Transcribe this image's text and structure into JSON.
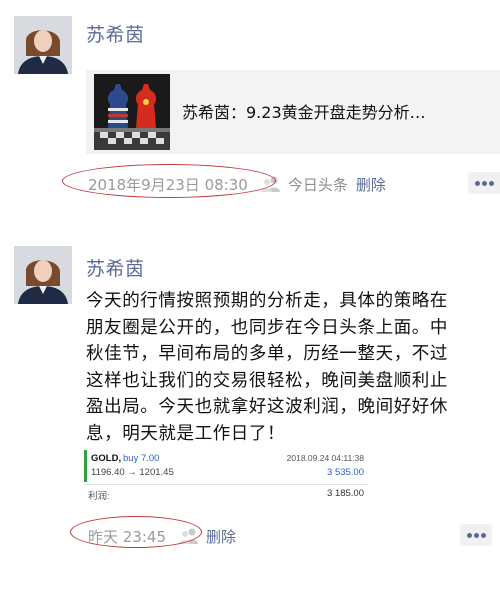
{
  "posts": [
    {
      "author": "苏希茵",
      "share_title": "苏希茵：9.23黄金开盘走势分析…",
      "time": "2018年9月23日 08:30",
      "source": "今日头条",
      "delete_label": "删除"
    },
    {
      "author": "苏希茵",
      "text_lines": [
        "今天的行情按照预期的分析走，具体的策略在",
        "朋友圈是公开的，也同步在今日头条上面。中",
        "秋佳节，早间布局的多单，历经一整天，不过",
        "这样也让我们的交易很轻松，晚间美盘顺利止",
        "盈出局。今天也就拿好这波利润，晚间好好休",
        "息，明天就是工作日了！"
      ],
      "trade": {
        "symbol": "GOLD,",
        "direction": "buy 7.00",
        "datetime": "2018.09.24 04:11:38",
        "prices": "1196.40 → 1201.45",
        "profit": "3 535.00",
        "profit_label": "利润:",
        "profit_total": "3 185.00"
      },
      "time": "昨天 23:45",
      "delete_label": "删除"
    }
  ],
  "colors": {
    "author": "#5b6b95",
    "time": "#9a9a9a",
    "highlight_oval": "#c0393b",
    "trade_buy": "#2a5fc4",
    "trade_marker": "#2aa43a"
  }
}
